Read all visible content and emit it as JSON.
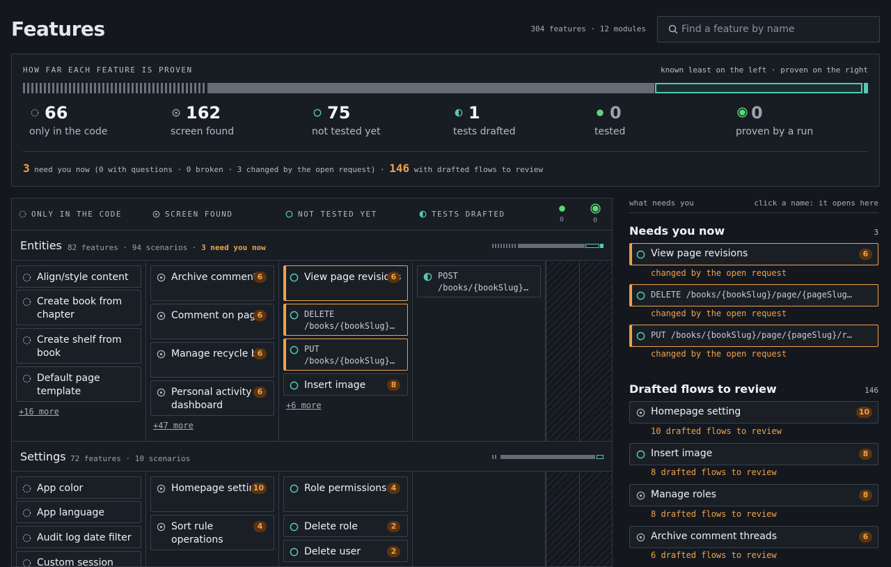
{
  "header": {
    "title": "Features",
    "counts": "304 features · 12 modules",
    "search_placeholder": "Find a feature by name"
  },
  "summary": {
    "title": "HOW FAR EACH FEATURE IS PROVEN",
    "hint": "known least on the left · proven on the right",
    "stats": [
      {
        "value": "66",
        "label": "only in the code",
        "icon": "dashed-circle-icon"
      },
      {
        "value": "162",
        "label": "screen found",
        "icon": "dot-circle-icon"
      },
      {
        "value": "75",
        "label": "not tested yet",
        "icon": "open-circle-icon"
      },
      {
        "value": "1",
        "label": "tests drafted",
        "icon": "half-circle-icon"
      },
      {
        "value": "0",
        "label": "tested",
        "icon": "filled-circle-icon"
      },
      {
        "value": "0",
        "label": "proven by a run",
        "icon": "ringed-circle-icon"
      }
    ],
    "need_count": "3",
    "need_text": "need you now (0 with questions · 0 broken · 3 changed by the open request) ·",
    "drafted_count": "146",
    "drafted_text": "with drafted flows to review"
  },
  "columns": [
    {
      "label": "ONLY IN THE CODE",
      "icon": "dashed-circle-icon"
    },
    {
      "label": "SCREEN FOUND",
      "icon": "dot-circle-icon"
    },
    {
      "label": "NOT TESTED YET",
      "icon": "open-circle-icon"
    },
    {
      "label": "TESTS DRAFTED",
      "icon": "half-circle-icon"
    },
    {
      "label": "0",
      "icon": "filled-circle-icon"
    },
    {
      "label": "0",
      "icon": "ringed-circle-icon"
    }
  ],
  "groups": [
    {
      "name": "Entities",
      "meta": "82 features · 94 scenarios ·",
      "warn": "3 need you now",
      "code": [
        "Align/style content",
        "Create book from chapter",
        "Create shelf from book",
        "Default page template"
      ],
      "code_more": "+16 more",
      "screen": [
        {
          "label": "Archive comment…",
          "badge": "6"
        },
        {
          "label": "Comment on page",
          "badge": "6"
        },
        {
          "label": "Manage recycle bin",
          "badge": "6"
        },
        {
          "label": "Personal activity dashboard",
          "badge": "6"
        }
      ],
      "screen_more": "+47 more",
      "nottested": [
        {
          "label": "View page revisions",
          "badge": "6"
        },
        {
          "label": "DELETE /books/{bookSlug}…",
          "badge": ""
        },
        {
          "label": "PUT /books/{bookSlug}…",
          "badge": ""
        },
        {
          "label": "Insert image",
          "badge": "8"
        }
      ],
      "nottested_more": "+6 more",
      "drafted": [
        {
          "label": "POST /books/{bookSlug}…"
        }
      ]
    },
    {
      "name": "Settings",
      "meta": "72 features · 10 scenarios",
      "code": [
        "App color",
        "App language",
        "Audit log date filter",
        "Custom session"
      ],
      "screen": [
        {
          "label": "Homepage setting",
          "badge": "10"
        },
        {
          "label": "Sort rule operations",
          "badge": "4"
        }
      ],
      "nottested": [
        {
          "label": "Role permissions",
          "badge": "4"
        },
        {
          "label": "Delete role",
          "badge": "2"
        },
        {
          "label": "Delete user",
          "badge": "2"
        }
      ]
    }
  ],
  "side": {
    "left_hint": "what needs you",
    "right_hint": "click a name: it opens here",
    "needs_title": "Needs you now",
    "needs_count": "3",
    "needs": [
      {
        "label": "View page revisions",
        "badge": "6",
        "note": "changed by the open request"
      },
      {
        "label": "DELETE /books/{bookSlug}/page/{pageSlug…",
        "badge": "",
        "note": "changed by the open request"
      },
      {
        "label": "PUT /books/{bookSlug}/page/{pageSlug}/r…",
        "badge": "",
        "note": "changed by the open request"
      }
    ],
    "drafted_title": "Drafted flows to review",
    "drafted_count": "146",
    "drafted": [
      {
        "label": "Homepage setting",
        "badge": "10",
        "note": "10 drafted flows to review",
        "icon": "dot-circle-icon"
      },
      {
        "label": "Insert image",
        "badge": "8",
        "note": "8 drafted flows to review",
        "icon": "open-circle-icon"
      },
      {
        "label": "Manage roles",
        "badge": "8",
        "note": "8 drafted flows to review",
        "icon": "dot-circle-icon"
      },
      {
        "label": "Archive comment threads",
        "badge": "6",
        "note": "6 drafted flows to review",
        "icon": "dot-circle-icon"
      }
    ]
  }
}
